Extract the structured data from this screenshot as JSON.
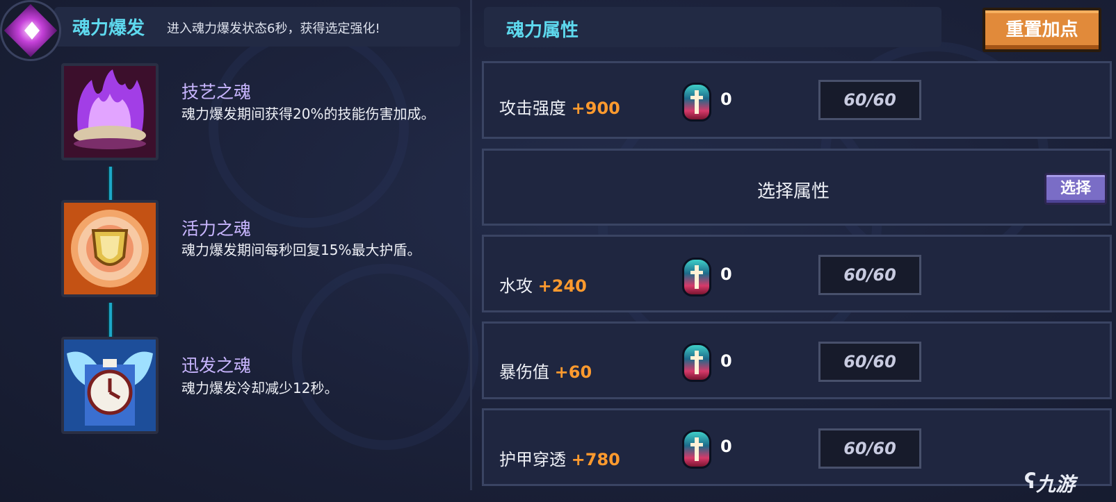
{
  "left_panel": {
    "title": "魂力爆发",
    "description": "进入魂力爆发状态6秒，获得选定强化!",
    "skills": [
      {
        "name": "技艺之魂",
        "description": "魂力爆发期间获得20%的技能伤害加成。",
        "icon": "purple-flame-skill-icon",
        "color": "#9c36e0"
      },
      {
        "name": "活力之魂",
        "description": "魂力爆发期间每秒回复15%最大护盾。",
        "icon": "golden-shield-skill-icon",
        "color": "#e97a2a"
      },
      {
        "name": "迅发之魂",
        "description": "魂力爆发冷却减少12秒。",
        "icon": "winged-clock-skill-icon",
        "color": "#2f8fe0"
      }
    ]
  },
  "right_panel": {
    "title": "魂力属性",
    "reset_label": "重置加点",
    "select_row": {
      "title": "选择属性",
      "button_label": "选择"
    },
    "stats": [
      {
        "name": "攻击强度",
        "bonus": "+900",
        "count": "0",
        "progress": "60/60"
      },
      {
        "name": "水攻",
        "bonus": "+240",
        "count": "0",
        "progress": "60/60"
      },
      {
        "name": "暴伤值",
        "bonus": "+60",
        "count": "0",
        "progress": "60/60"
      },
      {
        "name": "护甲穿透",
        "bonus": "+780",
        "count": "0",
        "progress": "60/60"
      }
    ]
  },
  "watermark": "九游",
  "colors": {
    "accent_cyan": "#5ed9ee",
    "bonus_orange": "#ff9a2e",
    "reset_orange": "#e18a3a",
    "select_purple": "#7a6dc6"
  }
}
